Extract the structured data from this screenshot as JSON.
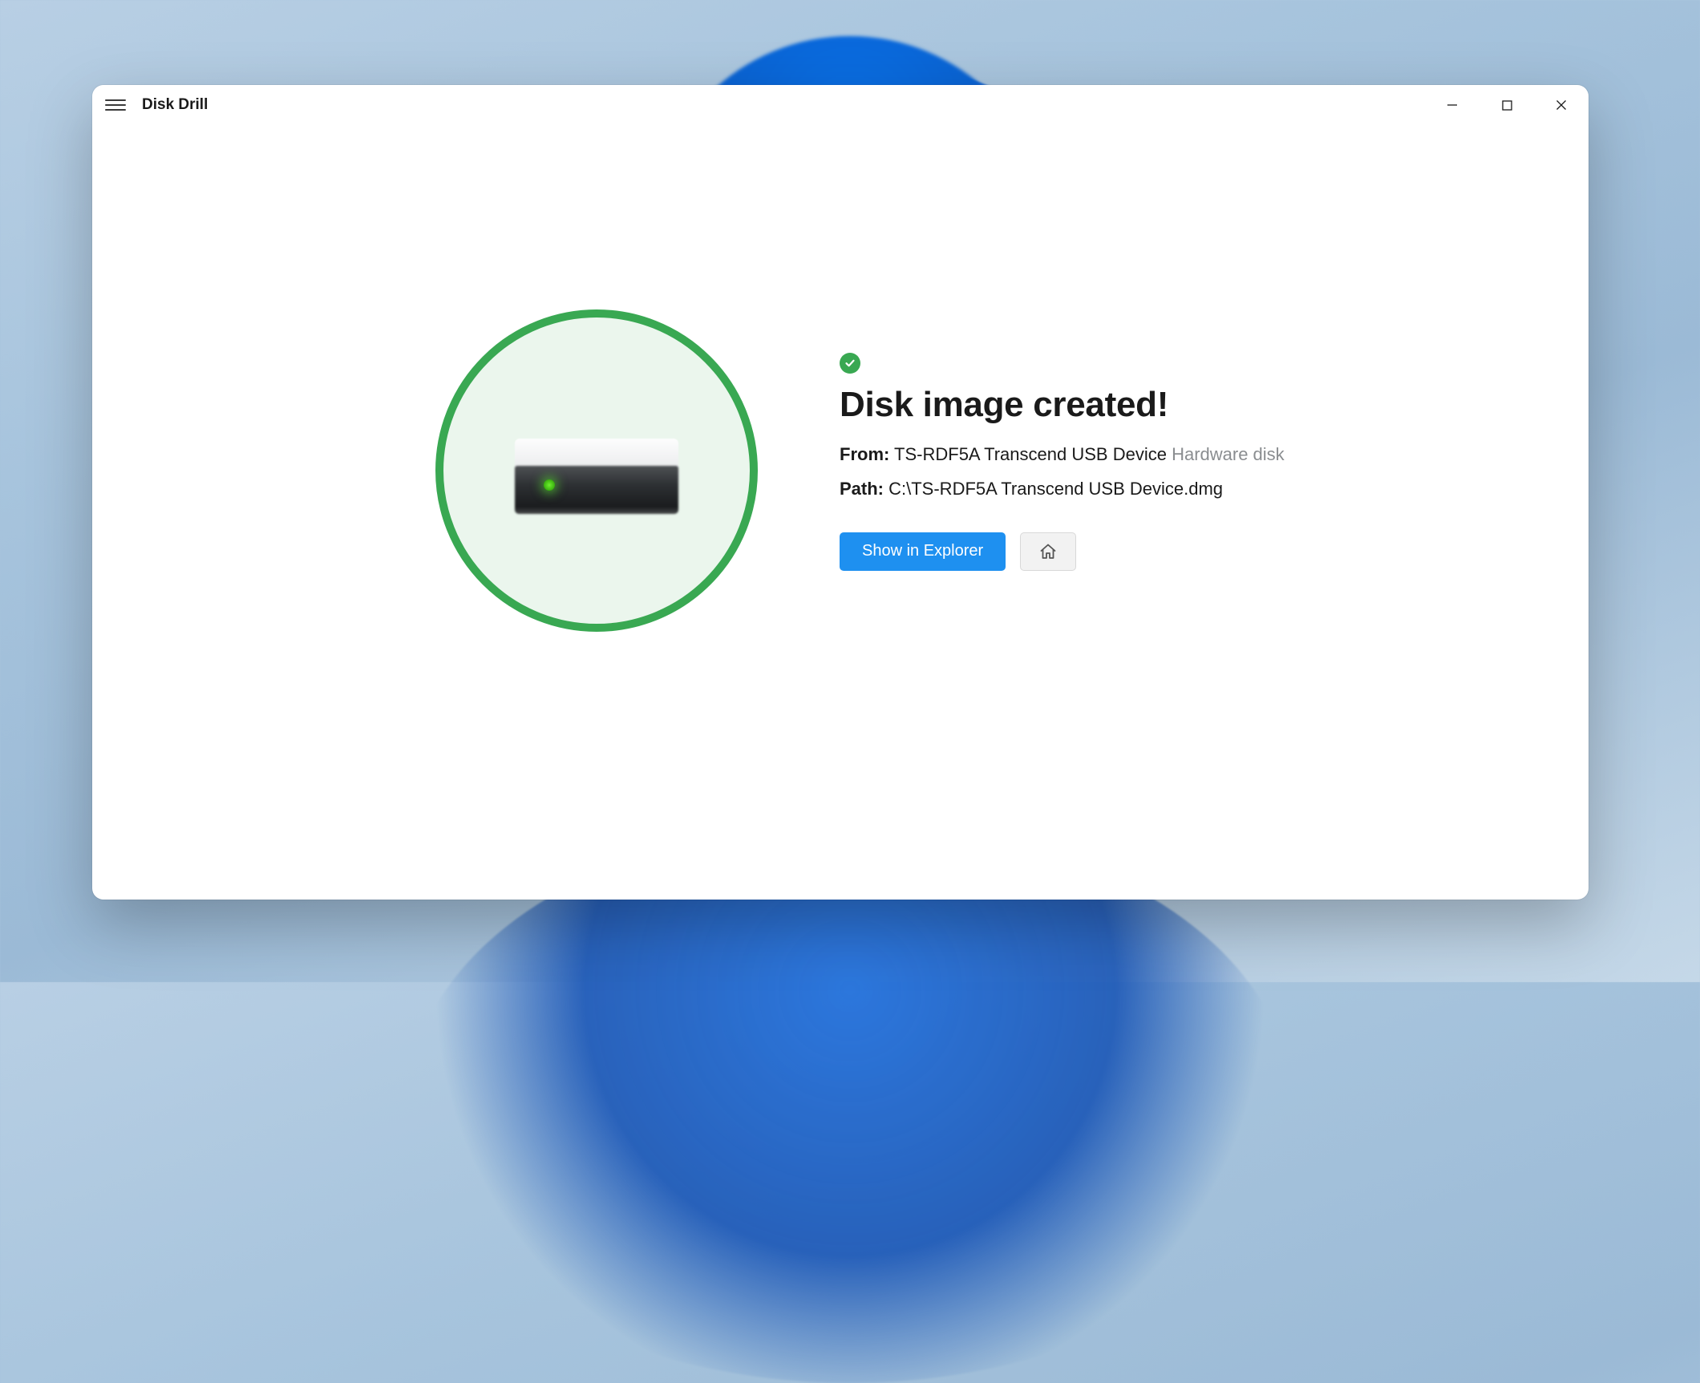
{
  "app": {
    "title": "Disk Drill"
  },
  "result": {
    "headline": "Disk image created!",
    "from_label": "From:",
    "from_value": "TS-RDF5A Transcend USB Device",
    "from_type": "Hardware disk",
    "path_label": "Path:",
    "path_value": "C:\\TS-RDF5A Transcend USB Device.dmg"
  },
  "actions": {
    "show_in_explorer": "Show in Explorer"
  },
  "colors": {
    "accent": "#1e90f0",
    "success": "#39a852"
  }
}
